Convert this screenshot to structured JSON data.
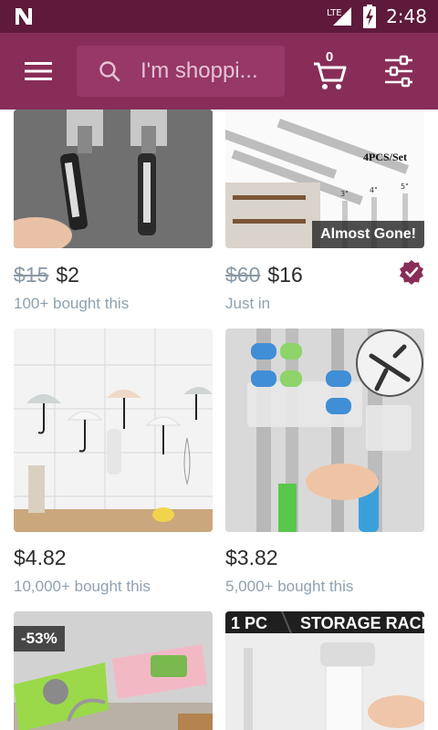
{
  "status_bar": {
    "network": "LTE",
    "time": "2:48"
  },
  "search": {
    "placeholder": "I'm shoppi..."
  },
  "cart": {
    "count": "0"
  },
  "colors": {
    "status_bar": "#5e1a3a",
    "app_bar": "#882d57",
    "accent": "#882d57"
  },
  "products": [
    {
      "old_price": "$15",
      "price": "$2",
      "subtitle": "100+ bought this"
    },
    {
      "old_price": "$60",
      "price": "$16",
      "subtitle": "Just in",
      "badge": "Almost Gone!",
      "image_text": "4PCS/Set",
      "sizes": [
        "3\"",
        "4\"",
        "5\""
      ]
    },
    {
      "price": "$4.82",
      "subtitle": "10,000+ bought this"
    },
    {
      "price": "$3.82",
      "subtitle": "5,000+ bought this"
    },
    {
      "badge": "-53%"
    },
    {
      "banner_left": "1 PC",
      "banner_right": "STORAGE RACK"
    }
  ]
}
